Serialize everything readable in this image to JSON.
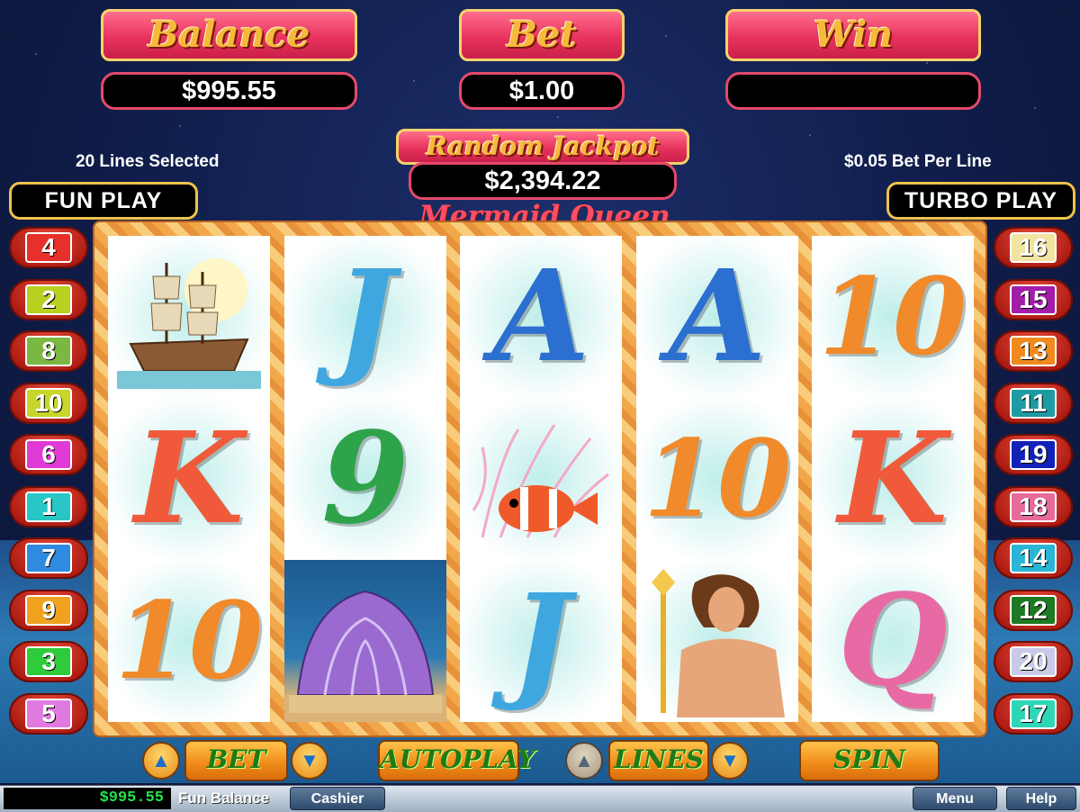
{
  "header": {
    "balance": {
      "label": "Balance",
      "value": "$995.55"
    },
    "bet": {
      "label": "Bet",
      "value": "$1.00"
    },
    "win": {
      "label": "Win",
      "value": ""
    },
    "jackpot": {
      "label": "Random Jackpot",
      "value": "$2,394.22"
    }
  },
  "info": {
    "lines_selected": "20 Lines Selected",
    "bet_per_line": "$0.05 Bet Per Line"
  },
  "modes": {
    "fun_play": "FUN PLAY",
    "turbo_play": "TURBO PLAY"
  },
  "game_title": "Mermaid Queen",
  "reels": [
    [
      {
        "symbol": "ship-icon"
      },
      {
        "symbol": "K"
      },
      {
        "symbol": "10"
      }
    ],
    [
      {
        "symbol": "J"
      },
      {
        "symbol": "9"
      },
      {
        "symbol": "clam-shell-icon"
      }
    ],
    [
      {
        "symbol": "A"
      },
      {
        "symbol": "clownfish-icon"
      },
      {
        "symbol": "J"
      }
    ],
    [
      {
        "symbol": "A"
      },
      {
        "symbol": "10"
      },
      {
        "symbol": "merman-icon"
      }
    ],
    [
      {
        "symbol": "10"
      },
      {
        "symbol": "K"
      },
      {
        "symbol": "Q"
      }
    ]
  ],
  "left_lines": [
    {
      "label": "4",
      "color": "#e8302a"
    },
    {
      "label": "2",
      "color": "#b8d020"
    },
    {
      "label": "8",
      "color": "#7bb842"
    },
    {
      "label": "10",
      "color": "#c6d62a"
    },
    {
      "label": "6",
      "color": "#e03ad4"
    },
    {
      "label": "1",
      "color": "#29c6c6"
    },
    {
      "label": "7",
      "color": "#2e8be0"
    },
    {
      "label": "9",
      "color": "#f0a21e"
    },
    {
      "label": "3",
      "color": "#2ecc3a"
    },
    {
      "label": "5",
      "color": "#e07ae0"
    }
  ],
  "right_lines": [
    {
      "label": "16",
      "color": "#f3e3a0"
    },
    {
      "label": "15",
      "color": "#a21ea8"
    },
    {
      "label": "13",
      "color": "#f08a1e"
    },
    {
      "label": "11",
      "color": "#1e9aa2"
    },
    {
      "label": "19",
      "color": "#1222b8"
    },
    {
      "label": "18",
      "color": "#e86a9a"
    },
    {
      "label": "14",
      "color": "#29b6d6"
    },
    {
      "label": "12",
      "color": "#1e7a22"
    },
    {
      "label": "20",
      "color": "#c9c9e8"
    },
    {
      "label": "17",
      "color": "#2ed6b6"
    }
  ],
  "controls": {
    "bet": "BET",
    "autoplay": "AUTOPLAY",
    "lines": "LINES",
    "spin": "SPIN"
  },
  "status": {
    "balance": "$995.55",
    "balance_label": "Fun Balance",
    "cashier": "Cashier",
    "menu": "Menu",
    "help": "Help"
  }
}
